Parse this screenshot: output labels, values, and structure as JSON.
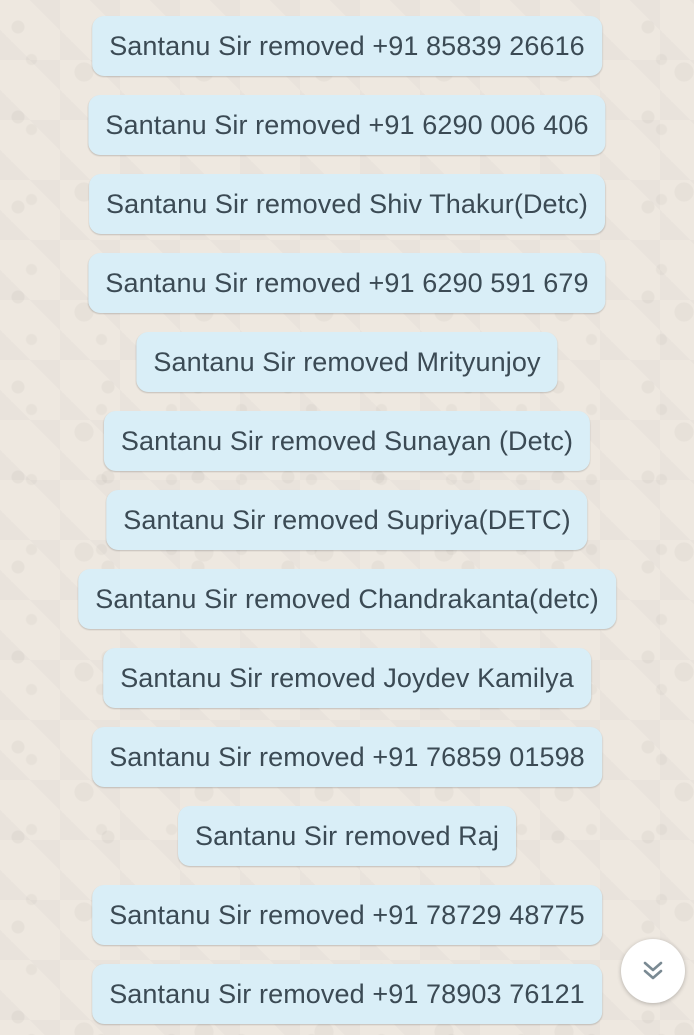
{
  "messages": [
    "Santanu Sir removed +91 85839 26616",
    "Santanu Sir removed +91 6290 006 406",
    "Santanu Sir removed Shiv Thakur(Detc)",
    "Santanu Sir removed +91 6290 591 679",
    "Santanu Sir removed Mrityunjoy",
    "Santanu Sir removed Sunayan (Detc)",
    "Santanu Sir removed Supriya(DETC)",
    "Santanu Sir removed Chandrakanta(detc)",
    "Santanu Sir removed Joydev Kamilya",
    "Santanu Sir removed +91 76859 01598",
    "Santanu Sir removed Raj",
    "Santanu Sir removed +91 78729 48775",
    "Santanu Sir removed +91 78903 76121"
  ],
  "scroll_button": {
    "icon": "double-chevron-down-icon"
  },
  "colors": {
    "bubble": "#d9eef7",
    "text": "#3b4a54",
    "wallpaper": "#eee8e0"
  }
}
